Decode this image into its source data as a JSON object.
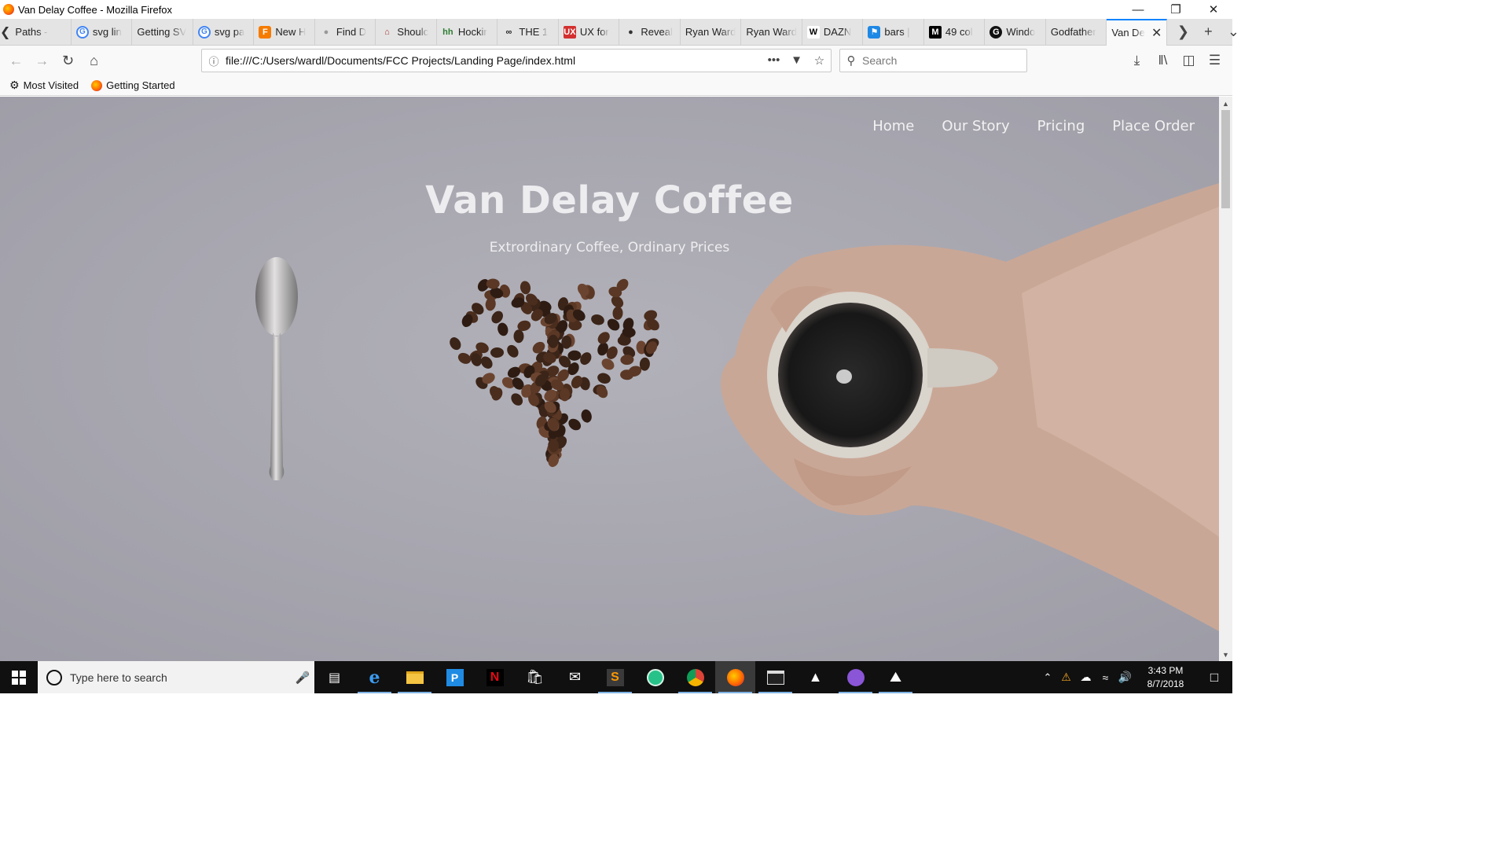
{
  "window": {
    "title": "Van Delay Coffee - Mozilla Firefox"
  },
  "tabs": [
    {
      "label": "Paths -",
      "icon": "none"
    },
    {
      "label": "svg lin",
      "icon": "google-icon"
    },
    {
      "label": "Getting SV",
      "icon": "none"
    },
    {
      "label": "svg pa",
      "icon": "google-icon"
    },
    {
      "label": "New H",
      "icon": "orange-f-icon"
    },
    {
      "label": "Find D",
      "icon": "shield-gray-icon"
    },
    {
      "label": "Shoulc",
      "icon": "house-icon"
    },
    {
      "label": "Hockir",
      "icon": "hh-icon"
    },
    {
      "label": "THE 1",
      "icon": "tripadvisor-icon"
    },
    {
      "label": "UX for",
      "icon": "ux-icon"
    },
    {
      "label": "Reveal",
      "icon": "profile-icon"
    },
    {
      "label": "Ryan Ward",
      "icon": "none"
    },
    {
      "label": "Ryan Ward",
      "icon": "none"
    },
    {
      "label": "DAZN",
      "icon": "wikipedia-icon"
    },
    {
      "label": "bars |",
      "icon": "flag-icon"
    },
    {
      "label": "49 col",
      "icon": "medium-icon"
    },
    {
      "label": "Windo",
      "icon": "g-circle-icon"
    },
    {
      "label": "Godfather",
      "icon": "none"
    },
    {
      "label": "Van De",
      "icon": "none",
      "active": true
    }
  ],
  "address": {
    "url": "file:///C:/Users/wardl/Documents/FCC Projects/Landing Page/index.html"
  },
  "search": {
    "placeholder": "Search"
  },
  "bookmarks": {
    "most_visited": "Most Visited",
    "getting_started": "Getting Started"
  },
  "site": {
    "nav": [
      "Home",
      "Our Story",
      "Pricing",
      "Place Order"
    ],
    "title": "Van Delay Coffee",
    "subtitle": "Extrordinary Coffee, Ordinary Prices"
  },
  "taskbar": {
    "search_placeholder": "Type here to search",
    "time": "3:43 PM",
    "date": "8/7/2018"
  },
  "colors": {
    "tab_accent": "#0a84ff",
    "hero_overlay": "#a2a1aa",
    "taskbar": "#101010"
  }
}
